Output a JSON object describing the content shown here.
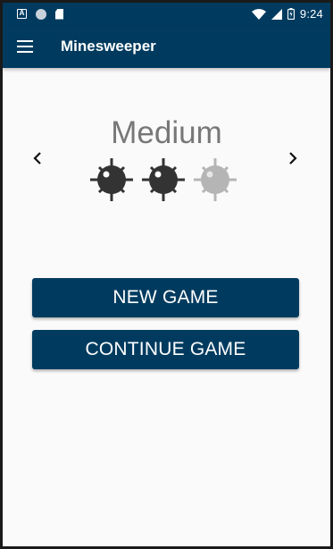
{
  "status_bar": {
    "time": "9:24",
    "left_icons": [
      "a-notification-icon",
      "circle-notification-icon",
      "sd-card-icon"
    ],
    "right_icons": [
      "wifi-icon",
      "signal-icon",
      "battery-icon"
    ]
  },
  "app_bar": {
    "title": "Minesweeper",
    "menu_icon": "hamburger-menu-icon"
  },
  "difficulty": {
    "label": "Medium",
    "level": 2,
    "max_level": 3,
    "prev_icon": "chevron-left-icon",
    "next_icon": "chevron-right-icon"
  },
  "buttons": {
    "new_game": "NEW GAME",
    "continue_game": "CONTINUE GAME"
  },
  "colors": {
    "primary": "#003b5f",
    "mine_active": "#333333",
    "mine_inactive": "#b5b5b5",
    "label": "#777777"
  }
}
